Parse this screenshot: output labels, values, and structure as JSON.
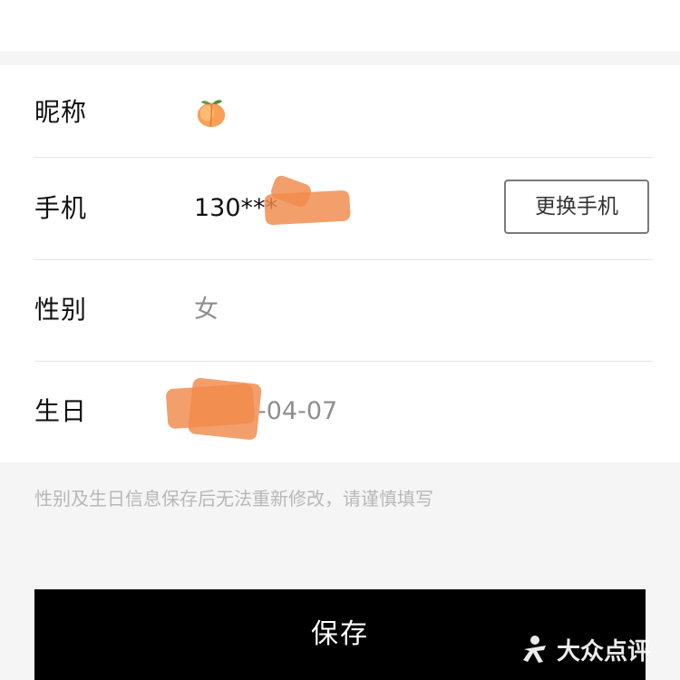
{
  "form": {
    "nickname": {
      "label": "昵称",
      "icon": "peach-emoji-icon"
    },
    "phone": {
      "label": "手机",
      "value": "130***",
      "change_button": "更换手机"
    },
    "gender": {
      "label": "性别",
      "value": "女"
    },
    "birthday": {
      "label": "生日",
      "value": "-04-07"
    }
  },
  "hint": "性别及生日信息保存后无法重新修改，请谨慎填写",
  "save_button": "保存",
  "watermark": {
    "text": "大众点评",
    "icon": "dianping-logo-icon"
  },
  "colors": {
    "accent_button": "#000000",
    "redaction": "#f08a4b",
    "hint_text": "#b8b8b8"
  }
}
